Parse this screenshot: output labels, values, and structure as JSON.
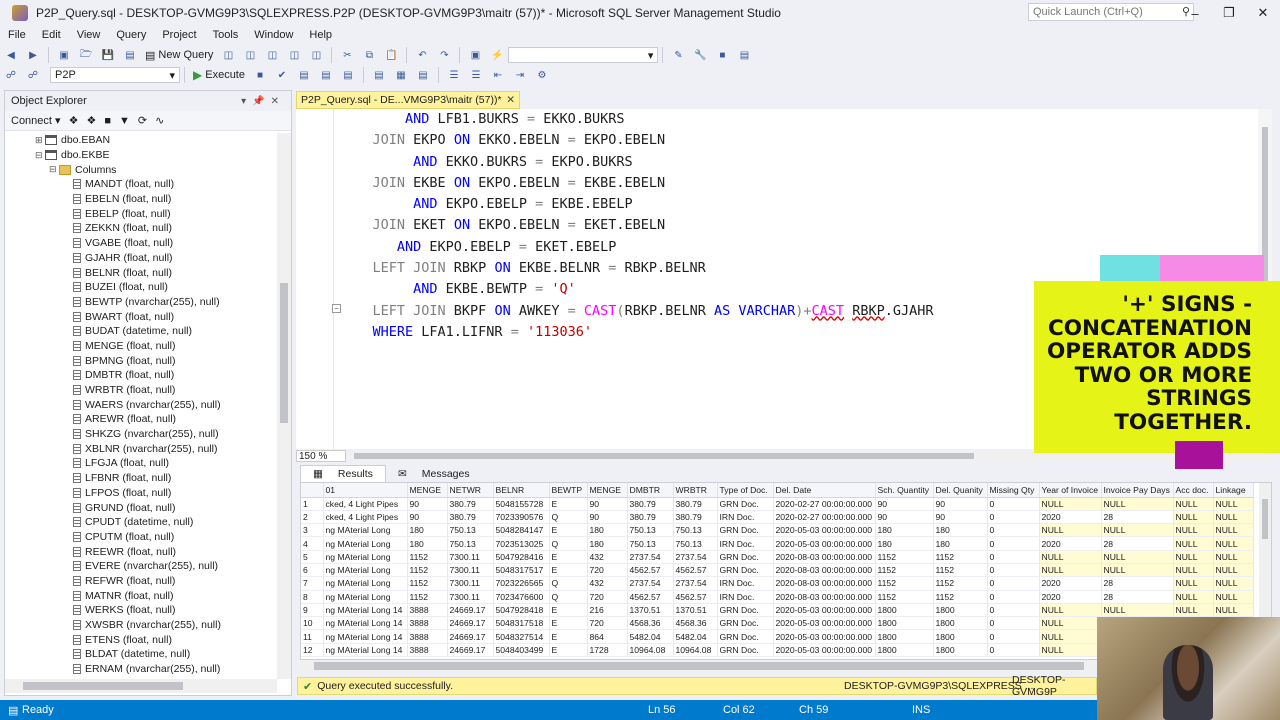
{
  "window": {
    "title": "P2P_Query.sql - DESKTOP-GVMG9P3\\SQLEXPRESS.P2P (DESKTOP-GVMG9P3\\maitr (57))* - Microsoft SQL Server Management Studio",
    "quick_launch": "Quick Launch (Ctrl+Q)"
  },
  "menu": [
    "File",
    "Edit",
    "View",
    "Query",
    "Project",
    "Tools",
    "Window",
    "Help"
  ],
  "toolbar": {
    "new_query": "New Query",
    "database": "P2P",
    "execute": "Execute"
  },
  "object_explorer": {
    "title": "Object Explorer",
    "connect": "Connect",
    "tree": [
      {
        "label": "dbo.EBAN",
        "indent": 2,
        "icon": "table",
        "exp": "+"
      },
      {
        "label": "dbo.EKBE",
        "indent": 2,
        "icon": "table",
        "exp": "−"
      },
      {
        "label": "Columns",
        "indent": 3,
        "icon": "folder",
        "exp": "−"
      },
      {
        "label": "MANDT (float, null)",
        "indent": 4,
        "icon": "col"
      },
      {
        "label": "EBELN (float, null)",
        "indent": 4,
        "icon": "col"
      },
      {
        "label": "EBELP (float, null)",
        "indent": 4,
        "icon": "col"
      },
      {
        "label": "ZEKKN (float, null)",
        "indent": 4,
        "icon": "col"
      },
      {
        "label": "VGABE (float, null)",
        "indent": 4,
        "icon": "col"
      },
      {
        "label": "GJAHR (float, null)",
        "indent": 4,
        "icon": "col"
      },
      {
        "label": "BELNR (float, null)",
        "indent": 4,
        "icon": "col"
      },
      {
        "label": "BUZEI (float, null)",
        "indent": 4,
        "icon": "col"
      },
      {
        "label": "BEWTP (nvarchar(255), null)",
        "indent": 4,
        "icon": "col"
      },
      {
        "label": "BWART (float, null)",
        "indent": 4,
        "icon": "col"
      },
      {
        "label": "BUDAT (datetime, null)",
        "indent": 4,
        "icon": "col"
      },
      {
        "label": "MENGE (float, null)",
        "indent": 4,
        "icon": "col"
      },
      {
        "label": "BPMNG (float, null)",
        "indent": 4,
        "icon": "col"
      },
      {
        "label": "DMBTR (float, null)",
        "indent": 4,
        "icon": "col"
      },
      {
        "label": "WRBTR (float, null)",
        "indent": 4,
        "icon": "col"
      },
      {
        "label": "WAERS (nvarchar(255), null)",
        "indent": 4,
        "icon": "col"
      },
      {
        "label": "AREWR (float, null)",
        "indent": 4,
        "icon": "col"
      },
      {
        "label": "SHKZG (nvarchar(255), null)",
        "indent": 4,
        "icon": "col"
      },
      {
        "label": "XBLNR (nvarchar(255), null)",
        "indent": 4,
        "icon": "col"
      },
      {
        "label": "LFGJA (float, null)",
        "indent": 4,
        "icon": "col"
      },
      {
        "label": "LFBNR (float, null)",
        "indent": 4,
        "icon": "col"
      },
      {
        "label": "LFPOS (float, null)",
        "indent": 4,
        "icon": "col"
      },
      {
        "label": "GRUND (float, null)",
        "indent": 4,
        "icon": "col"
      },
      {
        "label": "CPUDT (datetime, null)",
        "indent": 4,
        "icon": "col"
      },
      {
        "label": "CPUTM (float, null)",
        "indent": 4,
        "icon": "col"
      },
      {
        "label": "REEWR (float, null)",
        "indent": 4,
        "icon": "col"
      },
      {
        "label": "EVERE (nvarchar(255), null)",
        "indent": 4,
        "icon": "col"
      },
      {
        "label": "REFWR (float, null)",
        "indent": 4,
        "icon": "col"
      },
      {
        "label": "MATNR (float, null)",
        "indent": 4,
        "icon": "col"
      },
      {
        "label": "WERKS (float, null)",
        "indent": 4,
        "icon": "col"
      },
      {
        "label": "XWSBR (nvarchar(255), null)",
        "indent": 4,
        "icon": "col"
      },
      {
        "label": "ETENS (float, null)",
        "indent": 4,
        "icon": "col"
      },
      {
        "label": "BLDAT (datetime, null)",
        "indent": 4,
        "icon": "col"
      },
      {
        "label": "ERNAM (nvarchar(255), null)",
        "indent": 4,
        "icon": "col"
      }
    ]
  },
  "editor": {
    "tab_label": "P2P_Query.sql - DE...VMG9P3\\maitr (57))*",
    "zoom": "150 %",
    "lines": [
      [
        [
          "",
          "        "
        ],
        [
          "kw",
          "AND"
        ],
        [
          "",
          " LFB1.BUKRS "
        ],
        [
          "gr",
          "="
        ],
        [
          "",
          " EKKO.BUKRS"
        ]
      ],
      [
        [
          "",
          "    "
        ],
        [
          "gr",
          "JOIN"
        ],
        [
          "",
          " EKPO "
        ],
        [
          "kw",
          "ON"
        ],
        [
          "",
          " EKKO.EBELN "
        ],
        [
          "gr",
          "="
        ],
        [
          "",
          " EKPO.EBELN"
        ]
      ],
      [
        [
          "",
          "         "
        ],
        [
          "kw",
          "AND"
        ],
        [
          "",
          " EKKO.BUKRS "
        ],
        [
          "gr",
          "="
        ],
        [
          "",
          " EKPO.BUKRS"
        ]
      ],
      [
        [
          "",
          "    "
        ],
        [
          "gr",
          "JOIN"
        ],
        [
          "",
          " EKBE "
        ],
        [
          "kw",
          "ON"
        ],
        [
          "",
          " EKPO.EBELN "
        ],
        [
          "gr",
          "="
        ],
        [
          "",
          " EKBE.EBELN"
        ]
      ],
      [
        [
          "",
          "         "
        ],
        [
          "kw",
          "AND"
        ],
        [
          "",
          " EKPO.EBELP "
        ],
        [
          "gr",
          "="
        ],
        [
          "",
          " EKBE.EBELP"
        ]
      ],
      [
        [
          "",
          "    "
        ],
        [
          "gr",
          "JOIN"
        ],
        [
          "",
          " EKET "
        ],
        [
          "kw",
          "ON"
        ],
        [
          "",
          " EKPO.EBELN "
        ],
        [
          "gr",
          "="
        ],
        [
          "",
          " EKET.EBELN"
        ]
      ],
      [
        [
          "",
          "       "
        ],
        [
          "kw",
          "AND"
        ],
        [
          "",
          " EKPO.EBELP "
        ],
        [
          "gr",
          "="
        ],
        [
          "",
          " EKET.EBELP"
        ]
      ],
      [
        [
          "",
          "    "
        ],
        [
          "gr",
          "LEFT JOIN"
        ],
        [
          "",
          " RBKP "
        ],
        [
          "kw",
          "ON"
        ],
        [
          "",
          " EKBE.BELNR "
        ],
        [
          "gr",
          "="
        ],
        [
          "",
          " RBKP.BELNR"
        ]
      ],
      [
        [
          "",
          "         "
        ],
        [
          "kw",
          "AND"
        ],
        [
          "",
          " EKBE.BEWTP "
        ],
        [
          "gr",
          "="
        ],
        [
          "",
          " "
        ],
        [
          "st",
          "'Q'"
        ]
      ],
      [
        [
          "",
          "    "
        ],
        [
          "gr",
          "LEFT JOIN"
        ],
        [
          "",
          " BKPF "
        ],
        [
          "kw",
          "ON"
        ],
        [
          "",
          " AWKEY "
        ],
        [
          "gr",
          "="
        ],
        [
          "",
          " "
        ],
        [
          "fn",
          "CAST"
        ],
        [
          "gr",
          "("
        ],
        [
          "",
          "RBKP.BELNR "
        ],
        [
          "kw",
          "AS"
        ],
        [
          "",
          " "
        ],
        [
          "kw",
          "VARCHAR"
        ],
        [
          "gr",
          ")+"
        ],
        [
          "fn err",
          "CAST"
        ],
        [
          "",
          " "
        ],
        [
          "err",
          "RBKP"
        ],
        [
          "",
          ".GJAHR"
        ]
      ],
      [
        [
          "",
          "    "
        ],
        [
          "kw",
          "WHERE"
        ],
        [
          "",
          " LFA1.LIFNR "
        ],
        [
          "gr",
          "="
        ],
        [
          "",
          " "
        ],
        [
          "st",
          "'113036'"
        ]
      ]
    ]
  },
  "annotation": {
    "lines": [
      "'+' SIGNS -",
      "CONCATENATION",
      "OPERATOR ADDS",
      "TWO OR MORE",
      "STRINGS",
      "TOGETHER."
    ],
    "colors": {
      "yellow": "#e5f317",
      "cyan": "#6fe1e2",
      "pink": "#f58be6",
      "magenta": "#a8119a"
    }
  },
  "results": {
    "tab_results": "Results",
    "tab_messages": "Messages",
    "columns": [
      "",
      "01",
      "MENGE",
      "NETWR",
      "BELNR",
      "BEWTP",
      "MENGE",
      "DMBTR",
      "WRBTR",
      "Type of Doc.",
      "Del. Date",
      "Sch. Quantity",
      "Del. Quanity",
      "Missing Qty",
      "Year of Invoice",
      "Invoice Pay Days",
      "Acc doc.",
      "Linkage"
    ],
    "rows": [
      [
        "1",
        "cked, 4 Light Pipes",
        "90",
        "380.79",
        "5048155728",
        "E",
        "90",
        "380.79",
        "380.79",
        "GRN Doc.",
        "2020-02-27 00:00:00.000",
        "90",
        "90",
        "0",
        "NULL",
        "NULL",
        "NULL",
        "NULL"
      ],
      [
        "2",
        "cked, 4 Light Pipes",
        "90",
        "380.79",
        "7023390576",
        "Q",
        "90",
        "380.79",
        "380.79",
        "IRN Doc.",
        "2020-02-27 00:00:00.000",
        "90",
        "90",
        "0",
        "2020",
        "28",
        "NULL",
        "NULL"
      ],
      [
        "3",
        "ng MAterial Long",
        "180",
        "750.13",
        "5048284147",
        "E",
        "180",
        "750.13",
        "750.13",
        "GRN Doc.",
        "2020-05-03 00:00:00.000",
        "180",
        "180",
        "0",
        "NULL",
        "NULL",
        "NULL",
        "NULL"
      ],
      [
        "4",
        "ng MAterial Long",
        "180",
        "750.13",
        "7023513025",
        "Q",
        "180",
        "750.13",
        "750.13",
        "IRN Doc.",
        "2020-05-03 00:00:00.000",
        "180",
        "180",
        "0",
        "2020",
        "28",
        "NULL",
        "NULL"
      ],
      [
        "5",
        "ng MAterial Long",
        "1152",
        "7300.11",
        "5047928416",
        "E",
        "432",
        "2737.54",
        "2737.54",
        "GRN Doc.",
        "2020-08-03 00:00:00.000",
        "1152",
        "1152",
        "0",
        "NULL",
        "NULL",
        "NULL",
        "NULL"
      ],
      [
        "6",
        "ng MAterial Long",
        "1152",
        "7300.11",
        "5048317517",
        "E",
        "720",
        "4562.57",
        "4562.57",
        "GRN Doc.",
        "2020-08-03 00:00:00.000",
        "1152",
        "1152",
        "0",
        "NULL",
        "NULL",
        "NULL",
        "NULL"
      ],
      [
        "7",
        "ng MAterial Long",
        "1152",
        "7300.11",
        "7023226565",
        "Q",
        "432",
        "2737.54",
        "2737.54",
        "IRN Doc.",
        "2020-08-03 00:00:00.000",
        "1152",
        "1152",
        "0",
        "2020",
        "28",
        "NULL",
        "NULL"
      ],
      [
        "8",
        "ng MAterial Long",
        "1152",
        "7300.11",
        "7023476600",
        "Q",
        "720",
        "4562.57",
        "4562.57",
        "IRN Doc.",
        "2020-08-03 00:00:00.000",
        "1152",
        "1152",
        "0",
        "2020",
        "28",
        "NULL",
        "NULL"
      ],
      [
        "9",
        "ng MAterial Long 14",
        "3888",
        "24669.17",
        "5047928418",
        "E",
        "216",
        "1370.51",
        "1370.51",
        "GRN Doc.",
        "2020-05-03 00:00:00.000",
        "1800",
        "1800",
        "0",
        "NULL",
        "NULL",
        "NULL",
        "NULL"
      ],
      [
        "10",
        "ng MAterial Long 14",
        "3888",
        "24669.17",
        "5048317518",
        "E",
        "720",
        "4568.36",
        "4568.36",
        "GRN Doc.",
        "2020-05-03 00:00:00.000",
        "1800",
        "1800",
        "0",
        "NULL",
        "",
        "",
        ""
      ],
      [
        "11",
        "ng MAterial Long 14",
        "3888",
        "24669.17",
        "5048327514",
        "E",
        "864",
        "5482.04",
        "5482.04",
        "GRN Doc.",
        "2020-05-03 00:00:00.000",
        "1800",
        "1800",
        "0",
        "NULL",
        "",
        "",
        ""
      ],
      [
        "12",
        "ng MAterial Long 14",
        "3888",
        "24669.17",
        "5048403499",
        "E",
        "1728",
        "10964.08",
        "10964.08",
        "GRN Doc.",
        "2020-05-03 00:00:00.000",
        "1800",
        "1800",
        "0",
        "NULL",
        "",
        "",
        ""
      ]
    ]
  },
  "query_status": {
    "message": "Query executed successfully.",
    "server": "DESKTOP-GVMG9P3\\SQLEXPRESS ...",
    "server2": "DESKTOP-GVMG9P"
  },
  "status_bar": {
    "ready": "Ready",
    "ln": "Ln 56",
    "col": "Col 62",
    "ch": "Ch 59",
    "ins": "INS"
  }
}
